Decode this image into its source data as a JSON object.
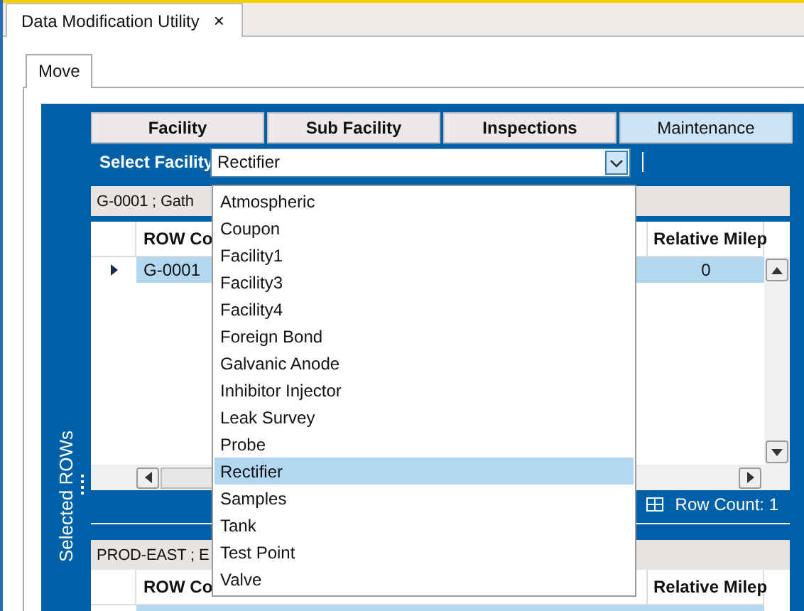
{
  "document_tab": {
    "title": "Data Modification Utility",
    "close": "×"
  },
  "inner_tabs": [
    {
      "label": "Move",
      "selected": true
    }
  ],
  "side_panel": {
    "title": "Selected ROWs"
  },
  "category_tabs": [
    {
      "label": "Facility",
      "selected": false
    },
    {
      "label": "Sub Facility",
      "selected": false
    },
    {
      "label": "Inspections",
      "selected": false
    },
    {
      "label": "Maintenance",
      "selected": true
    }
  ],
  "select_facility": {
    "label": "Select Facility",
    "value": "Rectifier",
    "expanded": true,
    "options": [
      {
        "label": "Atmospheric",
        "selected": false
      },
      {
        "label": "Coupon",
        "selected": false
      },
      {
        "label": "Facility1",
        "selected": false
      },
      {
        "label": "Facility3",
        "selected": false
      },
      {
        "label": "Facility4",
        "selected": false
      },
      {
        "label": "Foreign Bond",
        "selected": false
      },
      {
        "label": "Galvanic Anode",
        "selected": false
      },
      {
        "label": "Inhibitor Injector",
        "selected": false
      },
      {
        "label": "Leak Survey",
        "selected": false
      },
      {
        "label": "Probe",
        "selected": false
      },
      {
        "label": "Rectifier",
        "selected": true
      },
      {
        "label": "Samples",
        "selected": false
      },
      {
        "label": "Tank",
        "selected": false
      },
      {
        "label": "Test Point",
        "selected": false
      },
      {
        "label": "Valve",
        "selected": false
      }
    ]
  },
  "groups": [
    {
      "title": "G-0001 ; Gath",
      "columns": [
        "ROW Co",
        "Relative Milep"
      ],
      "rows": [
        {
          "cells": [
            "G-0001",
            "0"
          ],
          "selected": true,
          "current": true
        }
      ],
      "row_count": "Row Count: 1"
    },
    {
      "title": "PROD-EAST ; E",
      "columns": [
        "ROW Co",
        "Relative Milep"
      ],
      "rows": [
        {
          "selected": true
        }
      ]
    }
  ]
}
